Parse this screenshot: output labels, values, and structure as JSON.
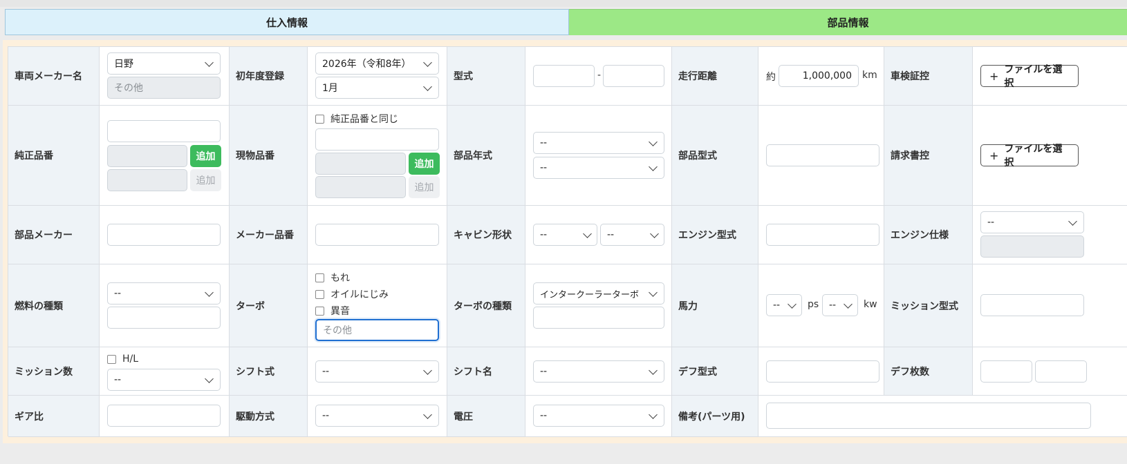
{
  "tabs": {
    "purchase_info": "仕入情報",
    "parts_info": "部品情報"
  },
  "labels": {
    "maker_name": "車両メーカー名",
    "first_reg": "初年度登録",
    "model_type": "型式",
    "mileage": "走行距離",
    "inspection_cert": "車検証控",
    "genuine_part_no": "純正品番",
    "actual_part_no": "現物品番",
    "part_year": "部品年式",
    "part_model": "部品型式",
    "invoice": "請求書控",
    "part_maker": "部品メーカー",
    "maker_part_no": "メーカー品番",
    "cabin_shape": "キャビン形状",
    "engine_model": "エンジン型式",
    "engine_spec": "エンジン仕様",
    "fuel_type": "燃料の種類",
    "turbo": "ターボ",
    "turbo_type": "ターボの種類",
    "horsepower": "馬力",
    "mission_model": "ミッション型式",
    "mission_count": "ミッション数",
    "shift_type": "シフト式",
    "shift_name": "シフト名",
    "diff_model": "デフ型式",
    "diff_count": "デフ枚数",
    "gear_ratio": "ギア比",
    "drive_type": "駆動方式",
    "voltage": "電圧",
    "remarks_parts": "備考(パーツ用)"
  },
  "values": {
    "maker_select": "日野",
    "maker_other_placeholder": "その他",
    "reg_year": "2026年（令和8年）",
    "reg_month": "1月",
    "model_dash": "-",
    "mileage_prefix": "約",
    "mileage_value": "1,000,000",
    "mileage_unit": "km",
    "file_button": "ファイルを選択",
    "add_button": "追加",
    "same_as_genuine": "純正品番と同じ",
    "empty_option": "--",
    "turbo_leak": "もれ",
    "turbo_oil": "オイルにじみ",
    "turbo_noise": "異音",
    "turbo_other_placeholder": "その他",
    "turbo_type_select": "インタークーラーターボ",
    "ps_unit": "ps",
    "kw_unit": "kw",
    "hl_label": "H/L"
  },
  "icons": {
    "plus": "+",
    "chevron": "chevron-down-icon"
  },
  "colors": {
    "accent_green": "#3dbb5d",
    "tab_blue": "#dcf1fb",
    "tab_green": "#9ce886",
    "focus_blue": "#1f6fd1"
  }
}
